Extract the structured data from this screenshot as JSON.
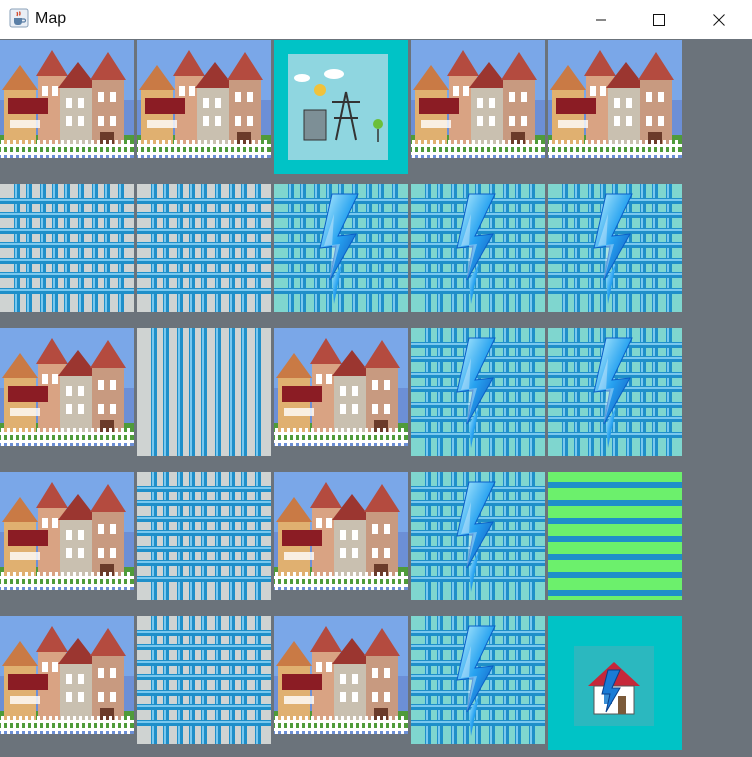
{
  "window": {
    "title": "Map",
    "minimize_icon": "minimize-icon",
    "maximize_icon": "maximize-icon",
    "close_icon": "close-icon",
    "app_icon": "java-coffee-cup-icon"
  },
  "colors": {
    "board_bg": "#6b737b",
    "wire_blue": "#1f8fc9",
    "powered_bg": "#7fd6cf",
    "unpowered_bg": "#cfd3d2",
    "green_bg": "#6cf06c",
    "source_bg": "#00d8d8"
  },
  "grid": {
    "columns": 5,
    "rows": 5,
    "cells": [
      [
        "house",
        "house",
        "power-plant",
        "house",
        "house"
      ],
      [
        "wire-grid-unpowered",
        "wire-grid-unpowered",
        "wire-grid-powered-bolt",
        "wire-grid-powered-bolt",
        "wire-grid-powered-bolt"
      ],
      [
        "house",
        "wire-vertical-unpowered",
        "house",
        "wire-grid-powered-bolt",
        "wire-grid-powered-bolt"
      ],
      [
        "house",
        "wire-grid-unpowered",
        "house",
        "wire-grid-powered-bolt",
        "wire-horizontal-green"
      ],
      [
        "house",
        "wire-grid-unpowered",
        "house",
        "wire-grid-powered-bolt",
        "powered-house"
      ]
    ]
  }
}
